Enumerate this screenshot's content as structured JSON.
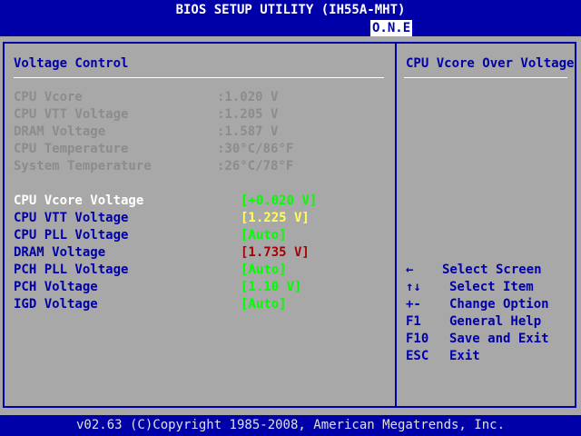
{
  "header": {
    "title": "BIOS SETUP UTILITY (IH55A-MHT)",
    "active_tab": "O.N.E"
  },
  "section": {
    "title": "Voltage Control"
  },
  "readings": [
    {
      "label": "CPU Vcore",
      "value": ":1.020 V"
    },
    {
      "label": "CPU VTT Voltage",
      "value": ":1.205 V"
    },
    {
      "label": "DRAM Voltage",
      "value": ":1.587 V"
    },
    {
      "label": "CPU Temperature",
      "value": ":30°C/86°F"
    },
    {
      "label": "System Temperature",
      "value": ":26°C/78°F"
    }
  ],
  "settings": [
    {
      "label": "CPU Vcore Voltage",
      "value": "[+0.020 V]",
      "color": "#00ff00",
      "selected": true
    },
    {
      "label": "CPU VTT Voltage",
      "value": "[1.225 V]",
      "color": "#ffff54"
    },
    {
      "label": "CPU PLL Voltage",
      "value": "[Auto]",
      "color": "#00ff00"
    },
    {
      "label": "DRAM Voltage",
      "value": "[1.735 V]",
      "color": "#a80000"
    },
    {
      "label": "PCH PLL Voltage",
      "value": "[Auto]",
      "color": "#00ff00"
    },
    {
      "label": "PCH Voltage",
      "value": "[1.10 V]",
      "color": "#00ff00"
    },
    {
      "label": "IGD Voltage",
      "value": "[Auto]",
      "color": "#00ff00"
    }
  ],
  "help": {
    "text": "CPU Vcore Over Voltage"
  },
  "keys": [
    {
      "key": "←",
      "action": "Select Screen"
    },
    {
      "key": "↑↓",
      "action": "Select Item"
    },
    {
      "key": "+-",
      "action": "Change Option"
    },
    {
      "key": "F1",
      "action": "General Help"
    },
    {
      "key": "F10",
      "action": "Save and Exit"
    },
    {
      "key": "ESC",
      "action": "Exit"
    }
  ],
  "footer": {
    "text": "v02.63 (C)Copyright 1985-2008, American Megatrends, Inc."
  }
}
